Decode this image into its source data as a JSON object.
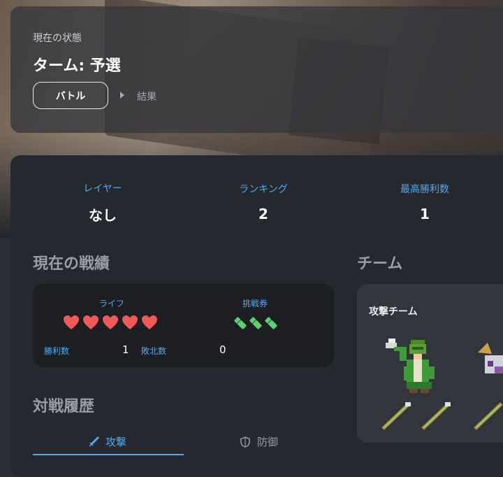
{
  "status": {
    "caption": "現在の状態",
    "title": "ターム: 予選",
    "steps": [
      "バトル",
      "結果"
    ]
  },
  "stats": [
    {
      "label": "レイヤー",
      "value": "なし"
    },
    {
      "label": "ランキング",
      "value": "2"
    },
    {
      "label": "最高勝利数",
      "value": "1"
    }
  ],
  "record": {
    "section_title": "現在の戦績",
    "life_label": "ライフ",
    "life_count": 5,
    "tickets_label": "挑戦券",
    "ticket_count": 3,
    "wins_label": "勝利数",
    "wins": "1",
    "losses_label": "敗北数",
    "losses": "0"
  },
  "team": {
    "section_title": "チーム",
    "name": "攻撃チーム"
  },
  "history": {
    "section_title": "対戦履歴",
    "tabs": [
      {
        "label": "攻撃",
        "icon": "sword-icon",
        "active": true
      },
      {
        "label": "防御",
        "icon": "shield-icon",
        "active": false
      }
    ]
  },
  "colors": {
    "accent": "#56a8e8",
    "heart": "#f0585a",
    "ticket": "#5bd16f"
  }
}
